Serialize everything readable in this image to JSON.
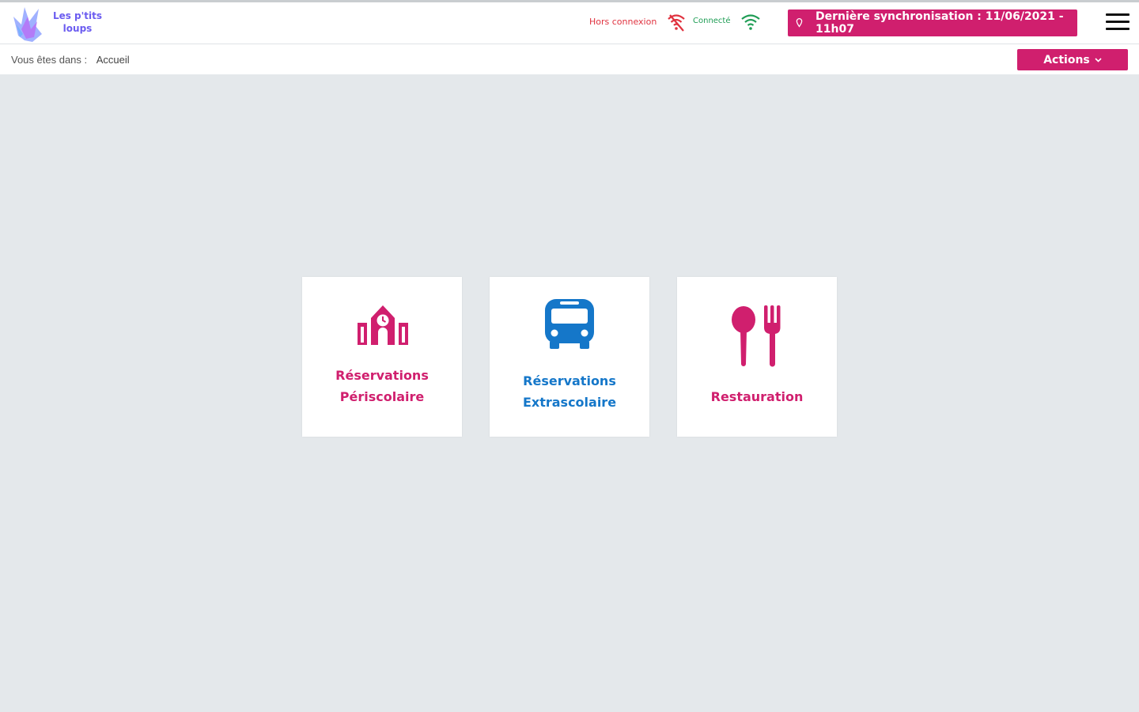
{
  "app": {
    "logo_line1": "Les p'tits",
    "logo_line2": "loups"
  },
  "header": {
    "offline_label": "Hors connexion",
    "online_label": "Connecté",
    "sync_label": "Dernière synchronisation : 11/06/2021 - 11h07"
  },
  "subbar": {
    "breadcrumb_prefix": "Vous êtes dans :",
    "breadcrumb_current": "Accueil",
    "actions_label": "Actions"
  },
  "tiles": [
    {
      "line1": "Réservations",
      "line2": "Périscolaire",
      "icon": "school-icon",
      "color": "#d01f6e"
    },
    {
      "line1": "Réservations",
      "line2": "Extrascolaire",
      "icon": "bus-icon",
      "color": "#1577c9"
    },
    {
      "line1": "Restauration",
      "icon": "cutlery-icon",
      "color": "#d01f6e"
    }
  ],
  "colors": {
    "accent": "#d01f6e",
    "offline": "#e0323f",
    "online": "#1f9d55",
    "background": "#e4e8eb"
  }
}
